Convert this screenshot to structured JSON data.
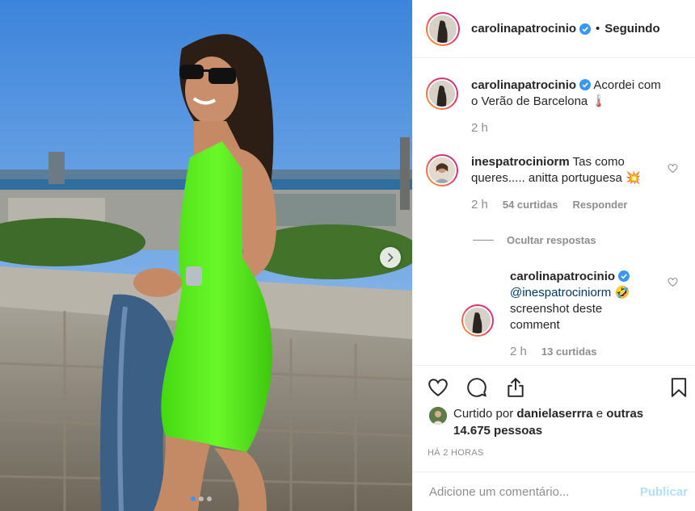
{
  "header": {
    "username": "carolinapatrocinio",
    "separator": "•",
    "follow_label": "Seguindo"
  },
  "caption": {
    "username": "carolinapatrocinio",
    "text": "Acordei com o Verão de Barcelona 🌡️",
    "time": "2 h"
  },
  "comments": [
    {
      "username": "inespatrociniorm",
      "text": "Tas como queres..... anitta portuguesa 💥",
      "time": "2 h",
      "likes": "54 curtidas",
      "reply_label": "Responder"
    }
  ],
  "hide_replies_label": "Ocultar respostas",
  "reply": {
    "username": "carolinapatrocinio",
    "mention": "@inespatrociniorm",
    "emoji": "🤣",
    "text": "screenshot deste comment",
    "time": "2 h",
    "likes": "13 curtidas"
  },
  "likes_summary": {
    "prefix": "Curtido por",
    "user": "danielaserrra",
    "middle": "e",
    "others": "outras 14.675 pessoas"
  },
  "timestamp": "HÁ 2 HORAS",
  "add_comment": {
    "placeholder": "Adicione um comentário...",
    "publish_label": "Publicar"
  },
  "carousel": {
    "slide_count": 3,
    "active_index": 0
  },
  "colors": {
    "accent": "#3897f0",
    "publish_disabled": "#b2dffc",
    "dress": "#5df21f"
  },
  "icons": [
    "verified-badge-icon",
    "chevron-right-icon",
    "heart-icon",
    "comment-icon",
    "share-icon",
    "bookmark-icon"
  ]
}
